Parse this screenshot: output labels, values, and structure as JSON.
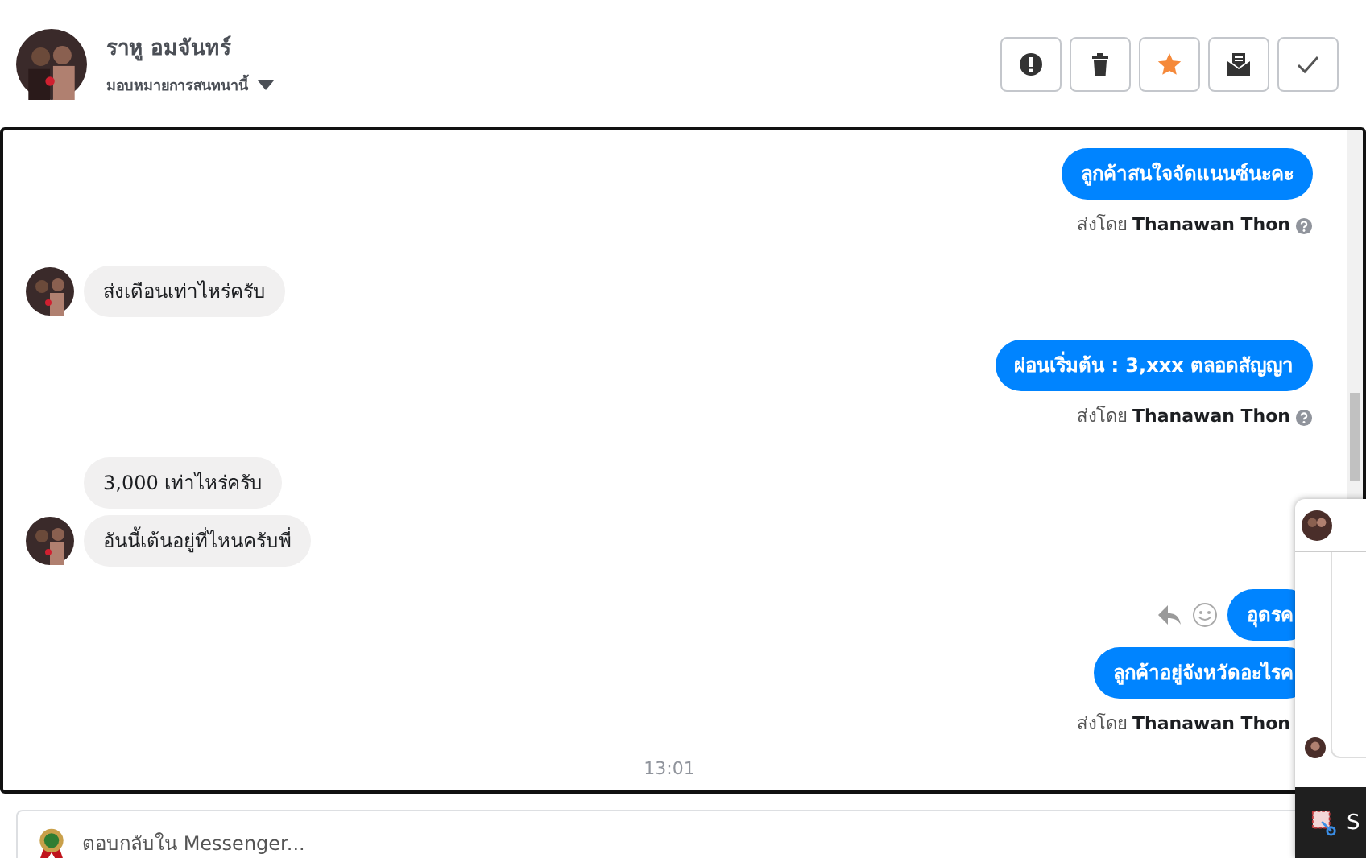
{
  "header": {
    "name": "ราหู อมจันทร์",
    "assign": "มอบหมายการสนทนานี้"
  },
  "actions": [
    {
      "kind": "alert"
    },
    {
      "kind": "trash"
    },
    {
      "kind": "star"
    },
    {
      "kind": "mail"
    },
    {
      "kind": "check"
    }
  ],
  "messages": [
    {
      "kind": "out",
      "texts": [
        "ลูกค้าสนใจจัดแนนซ์นะคะ"
      ],
      "sender_prefix": "ส่งโดย",
      "sender": "Thanawan Thon",
      "help": true,
      "hover_tools": false
    },
    {
      "kind": "in",
      "texts": [
        "ส่งเดือนเท่าไหร่ครับ"
      ]
    },
    {
      "kind": "out",
      "texts": [
        "ผ่อนเริ่มต้น : 3,xxx ตลอดสัญญา"
      ],
      "sender_prefix": "ส่งโดย",
      "sender": "Thanawan Thon",
      "help": true,
      "hover_tools": false
    },
    {
      "kind": "in",
      "texts": [
        "3,000 เท่าไหร่ครับ",
        "อันนี้เต้นอยู่ที่ไหนครับพี่"
      ]
    },
    {
      "kind": "out",
      "texts": [
        "อุดรค",
        "ลูกค้าอยู่จังหวัดอะไรค"
      ],
      "sender_prefix": "ส่งโดย",
      "sender": "Thanawan Thon",
      "help": false,
      "hover_tools": true
    }
  ],
  "time": "13:01",
  "reply": {
    "placeholder": "ตอบกลับใน Messenger..."
  },
  "taskbar": {
    "label": "S"
  }
}
